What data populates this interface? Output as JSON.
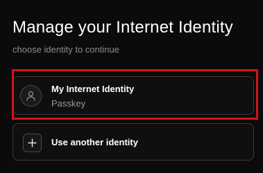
{
  "header": {
    "title": "Manage your Internet Identity",
    "subtitle": "choose identity to continue"
  },
  "identities": [
    {
      "name": "My Internet Identity",
      "type": "Passkey",
      "icon": "user-icon"
    }
  ],
  "actions": {
    "use_another_label": "Use another identity",
    "use_another_icon": "plus-icon"
  },
  "colors": {
    "background": "#0b0b0b",
    "card_border": "#3a3a3a",
    "highlight": "#d4131b",
    "muted_text": "#8d8d8d"
  }
}
